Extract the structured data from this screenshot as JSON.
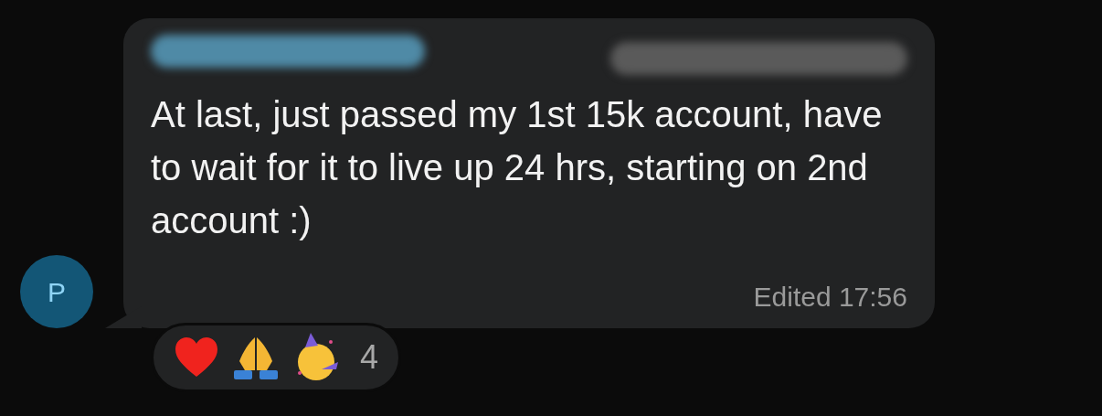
{
  "message": {
    "text": "At last, just passed my 1st 15k account, have to wait for it to live up 24 hrs, starting on 2nd account  :)",
    "edited_label": "Edited",
    "time": "17:56"
  },
  "avatar": {
    "initial": "P"
  },
  "reactions": {
    "emojis": [
      {
        "kind": "heart"
      },
      {
        "kind": "pray"
      },
      {
        "kind": "party"
      }
    ],
    "count": "4"
  }
}
